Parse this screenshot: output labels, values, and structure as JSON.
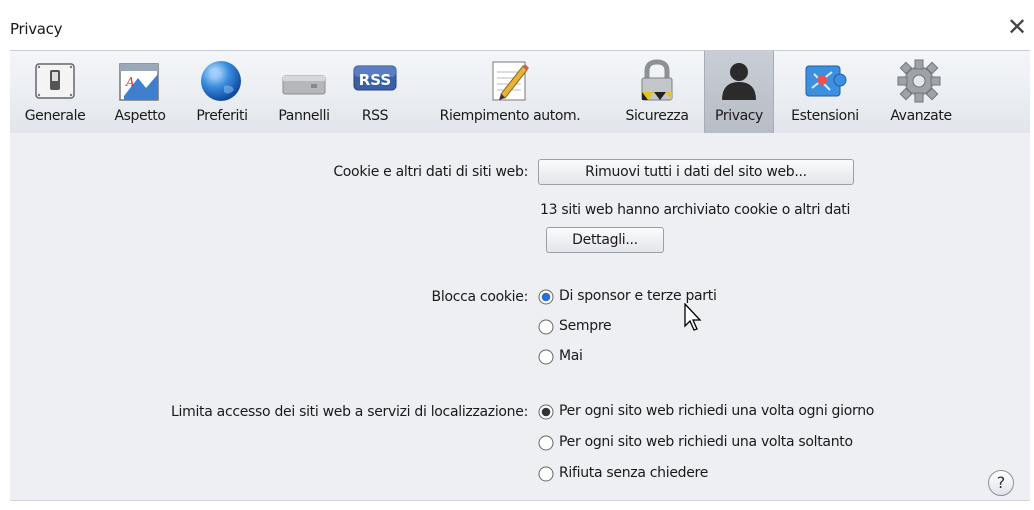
{
  "window": {
    "title": "Privacy",
    "close_glyph": "✕"
  },
  "toolbar": {
    "selected": "Privacy",
    "items": [
      {
        "label": "Generale",
        "icon": "switch-icon"
      },
      {
        "label": "Aspetto",
        "icon": "appearance-icon"
      },
      {
        "label": "Preferiti",
        "icon": "globe-icon"
      },
      {
        "label": "Pannelli",
        "icon": "panels-icon"
      },
      {
        "label": "RSS",
        "icon": "rss-icon",
        "badge": "RSS"
      },
      {
        "label": "Riempimento autom.",
        "icon": "pencil-icon"
      },
      {
        "label": "Sicurezza",
        "icon": "lock-icon"
      },
      {
        "label": "Privacy",
        "icon": "person-icon"
      },
      {
        "label": "Estensioni",
        "icon": "puzzle-icon"
      },
      {
        "label": "Avanzate",
        "icon": "gear-icon"
      }
    ]
  },
  "cookies": {
    "label": "Cookie e altri dati di siti web:",
    "remove_button": "Rimuovi tutti i dati del sito web...",
    "info": "13 siti web hanno archiviato cookie o altri dati",
    "details_button": "Dettagli..."
  },
  "block_cookies": {
    "label": "Blocca cookie:",
    "options": [
      {
        "label": "Di sponsor e terze parti",
        "selected": true
      },
      {
        "label": "Sempre",
        "selected": false
      },
      {
        "label": "Mai",
        "selected": false
      }
    ]
  },
  "location": {
    "label": "Limita accesso dei siti web a servizi di localizzazione:",
    "options": [
      {
        "label": "Per ogni sito web richiedi una volta ogni giorno",
        "selected": true
      },
      {
        "label": "Per ogni sito web richiedi una volta soltanto",
        "selected": false
      },
      {
        "label": "Rifiuta senza chiedere",
        "selected": false
      }
    ]
  },
  "help": {
    "glyph": "?"
  },
  "colors": {
    "radio_selected": "#2a6fd6",
    "toolbar_selected": "#bcc1c9"
  }
}
